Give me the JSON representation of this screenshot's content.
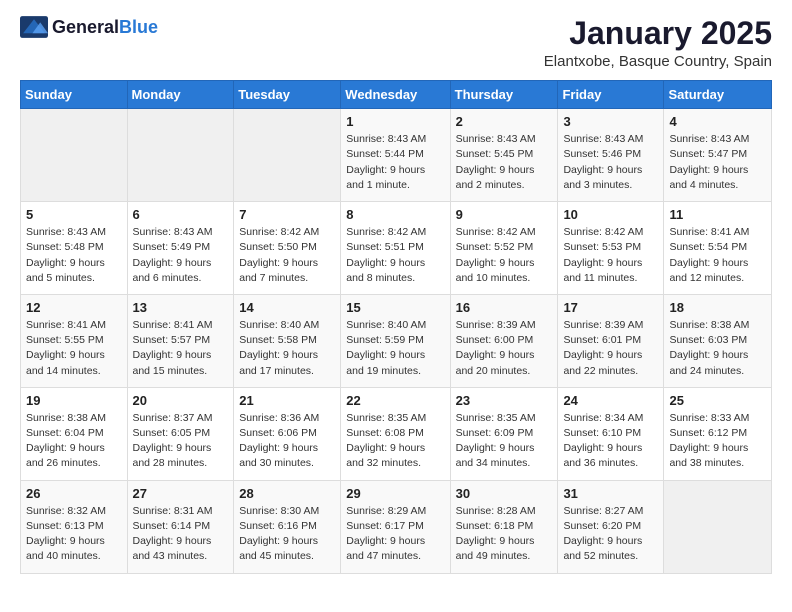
{
  "header": {
    "logo_general": "General",
    "logo_blue": "Blue",
    "month_title": "January 2025",
    "location": "Elantxobe, Basque Country, Spain"
  },
  "days_of_week": [
    "Sunday",
    "Monday",
    "Tuesday",
    "Wednesday",
    "Thursday",
    "Friday",
    "Saturday"
  ],
  "weeks": [
    [
      {
        "day": "",
        "sunrise": "",
        "sunset": "",
        "daylight": ""
      },
      {
        "day": "",
        "sunrise": "",
        "sunset": "",
        "daylight": ""
      },
      {
        "day": "",
        "sunrise": "",
        "sunset": "",
        "daylight": ""
      },
      {
        "day": "1",
        "sunrise": "Sunrise: 8:43 AM",
        "sunset": "Sunset: 5:44 PM",
        "daylight": "Daylight: 9 hours and 1 minute."
      },
      {
        "day": "2",
        "sunrise": "Sunrise: 8:43 AM",
        "sunset": "Sunset: 5:45 PM",
        "daylight": "Daylight: 9 hours and 2 minutes."
      },
      {
        "day": "3",
        "sunrise": "Sunrise: 8:43 AM",
        "sunset": "Sunset: 5:46 PM",
        "daylight": "Daylight: 9 hours and 3 minutes."
      },
      {
        "day": "4",
        "sunrise": "Sunrise: 8:43 AM",
        "sunset": "Sunset: 5:47 PM",
        "daylight": "Daylight: 9 hours and 4 minutes."
      }
    ],
    [
      {
        "day": "5",
        "sunrise": "Sunrise: 8:43 AM",
        "sunset": "Sunset: 5:48 PM",
        "daylight": "Daylight: 9 hours and 5 minutes."
      },
      {
        "day": "6",
        "sunrise": "Sunrise: 8:43 AM",
        "sunset": "Sunset: 5:49 PM",
        "daylight": "Daylight: 9 hours and 6 minutes."
      },
      {
        "day": "7",
        "sunrise": "Sunrise: 8:42 AM",
        "sunset": "Sunset: 5:50 PM",
        "daylight": "Daylight: 9 hours and 7 minutes."
      },
      {
        "day": "8",
        "sunrise": "Sunrise: 8:42 AM",
        "sunset": "Sunset: 5:51 PM",
        "daylight": "Daylight: 9 hours and 8 minutes."
      },
      {
        "day": "9",
        "sunrise": "Sunrise: 8:42 AM",
        "sunset": "Sunset: 5:52 PM",
        "daylight": "Daylight: 9 hours and 10 minutes."
      },
      {
        "day": "10",
        "sunrise": "Sunrise: 8:42 AM",
        "sunset": "Sunset: 5:53 PM",
        "daylight": "Daylight: 9 hours and 11 minutes."
      },
      {
        "day": "11",
        "sunrise": "Sunrise: 8:41 AM",
        "sunset": "Sunset: 5:54 PM",
        "daylight": "Daylight: 9 hours and 12 minutes."
      }
    ],
    [
      {
        "day": "12",
        "sunrise": "Sunrise: 8:41 AM",
        "sunset": "Sunset: 5:55 PM",
        "daylight": "Daylight: 9 hours and 14 minutes."
      },
      {
        "day": "13",
        "sunrise": "Sunrise: 8:41 AM",
        "sunset": "Sunset: 5:57 PM",
        "daylight": "Daylight: 9 hours and 15 minutes."
      },
      {
        "day": "14",
        "sunrise": "Sunrise: 8:40 AM",
        "sunset": "Sunset: 5:58 PM",
        "daylight": "Daylight: 9 hours and 17 minutes."
      },
      {
        "day": "15",
        "sunrise": "Sunrise: 8:40 AM",
        "sunset": "Sunset: 5:59 PM",
        "daylight": "Daylight: 9 hours and 19 minutes."
      },
      {
        "day": "16",
        "sunrise": "Sunrise: 8:39 AM",
        "sunset": "Sunset: 6:00 PM",
        "daylight": "Daylight: 9 hours and 20 minutes."
      },
      {
        "day": "17",
        "sunrise": "Sunrise: 8:39 AM",
        "sunset": "Sunset: 6:01 PM",
        "daylight": "Daylight: 9 hours and 22 minutes."
      },
      {
        "day": "18",
        "sunrise": "Sunrise: 8:38 AM",
        "sunset": "Sunset: 6:03 PM",
        "daylight": "Daylight: 9 hours and 24 minutes."
      }
    ],
    [
      {
        "day": "19",
        "sunrise": "Sunrise: 8:38 AM",
        "sunset": "Sunset: 6:04 PM",
        "daylight": "Daylight: 9 hours and 26 minutes."
      },
      {
        "day": "20",
        "sunrise": "Sunrise: 8:37 AM",
        "sunset": "Sunset: 6:05 PM",
        "daylight": "Daylight: 9 hours and 28 minutes."
      },
      {
        "day": "21",
        "sunrise": "Sunrise: 8:36 AM",
        "sunset": "Sunset: 6:06 PM",
        "daylight": "Daylight: 9 hours and 30 minutes."
      },
      {
        "day": "22",
        "sunrise": "Sunrise: 8:35 AM",
        "sunset": "Sunset: 6:08 PM",
        "daylight": "Daylight: 9 hours and 32 minutes."
      },
      {
        "day": "23",
        "sunrise": "Sunrise: 8:35 AM",
        "sunset": "Sunset: 6:09 PM",
        "daylight": "Daylight: 9 hours and 34 minutes."
      },
      {
        "day": "24",
        "sunrise": "Sunrise: 8:34 AM",
        "sunset": "Sunset: 6:10 PM",
        "daylight": "Daylight: 9 hours and 36 minutes."
      },
      {
        "day": "25",
        "sunrise": "Sunrise: 8:33 AM",
        "sunset": "Sunset: 6:12 PM",
        "daylight": "Daylight: 9 hours and 38 minutes."
      }
    ],
    [
      {
        "day": "26",
        "sunrise": "Sunrise: 8:32 AM",
        "sunset": "Sunset: 6:13 PM",
        "daylight": "Daylight: 9 hours and 40 minutes."
      },
      {
        "day": "27",
        "sunrise": "Sunrise: 8:31 AM",
        "sunset": "Sunset: 6:14 PM",
        "daylight": "Daylight: 9 hours and 43 minutes."
      },
      {
        "day": "28",
        "sunrise": "Sunrise: 8:30 AM",
        "sunset": "Sunset: 6:16 PM",
        "daylight": "Daylight: 9 hours and 45 minutes."
      },
      {
        "day": "29",
        "sunrise": "Sunrise: 8:29 AM",
        "sunset": "Sunset: 6:17 PM",
        "daylight": "Daylight: 9 hours and 47 minutes."
      },
      {
        "day": "30",
        "sunrise": "Sunrise: 8:28 AM",
        "sunset": "Sunset: 6:18 PM",
        "daylight": "Daylight: 9 hours and 49 minutes."
      },
      {
        "day": "31",
        "sunrise": "Sunrise: 8:27 AM",
        "sunset": "Sunset: 6:20 PM",
        "daylight": "Daylight: 9 hours and 52 minutes."
      },
      {
        "day": "",
        "sunrise": "",
        "sunset": "",
        "daylight": ""
      }
    ]
  ]
}
